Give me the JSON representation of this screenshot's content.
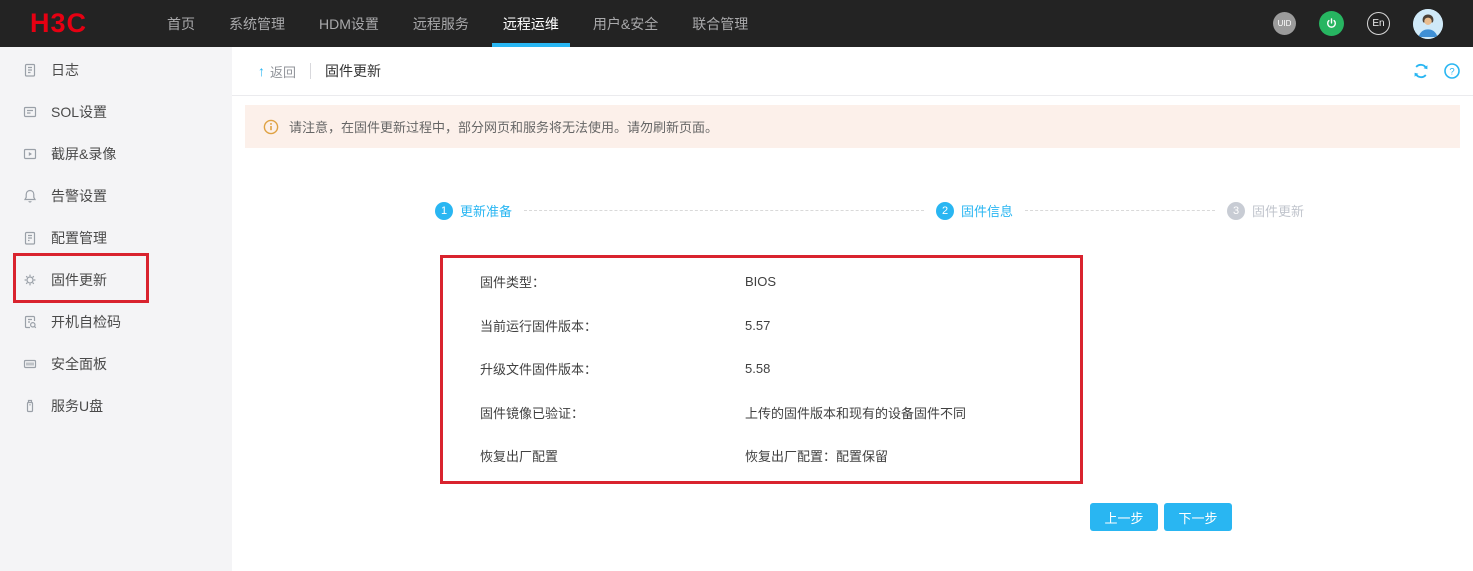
{
  "nav": {
    "logo_text": "H3C",
    "items": [
      {
        "label": "首页"
      },
      {
        "label": "系统管理"
      },
      {
        "label": "HDM设置"
      },
      {
        "label": "远程服务"
      },
      {
        "label": "远程运维",
        "active": true
      },
      {
        "label": "用户&安全"
      },
      {
        "label": "联合管理"
      }
    ],
    "uid_label": "UID",
    "language_label": "En"
  },
  "sidebar": {
    "items": [
      {
        "label": "日志",
        "icon": "log-icon"
      },
      {
        "label": "SOL设置",
        "icon": "sol-icon"
      },
      {
        "label": "截屏&录像",
        "icon": "screen-record-icon"
      },
      {
        "label": "告警设置",
        "icon": "alert-bell-icon"
      },
      {
        "label": "配置管理",
        "icon": "config-icon"
      },
      {
        "label": "固件更新",
        "icon": "firmware-gear-icon",
        "highlighted": true
      },
      {
        "label": "开机自检码",
        "icon": "post-code-icon"
      },
      {
        "label": "安全面板",
        "icon": "security-panel-icon"
      },
      {
        "label": "服务U盘",
        "icon": "usb-icon"
      }
    ]
  },
  "breadcrumb": {
    "back_arrow": "↑",
    "back_label": "返回",
    "title": "固件更新"
  },
  "banner": {
    "text": "请注意，在固件更新过程中，部分网页和服务将无法使用。请勿刷新页面。"
  },
  "stepper": {
    "steps": [
      {
        "num": "1",
        "label": "更新准备",
        "state": "active"
      },
      {
        "num": "2",
        "label": "固件信息",
        "state": "active"
      },
      {
        "num": "3",
        "label": "固件更新",
        "state": "pending"
      }
    ]
  },
  "firmware_info": {
    "rows": [
      {
        "label": "固件类型：",
        "value": "BIOS"
      },
      {
        "label": "当前运行固件版本：",
        "value": "5.57"
      },
      {
        "label": "升级文件固件版本：",
        "value": "5.58"
      },
      {
        "label": "固件镜像已验证：",
        "value": "上传的固件版本和现有的设备固件不同"
      },
      {
        "label": "恢复出厂配置",
        "value": "恢复出厂配置：配置保留"
      }
    ]
  },
  "actions": {
    "prev_label": "上一步",
    "next_label": "下一步"
  },
  "colors": {
    "accent_blue": "#29b6f2",
    "annotation_red": "#d9232e",
    "nav_bg": "#232323",
    "logo_red": "#e60012",
    "power_green": "#27b561",
    "banner_bg": "#fcf0ea",
    "banner_icon_orange": "#dfa243",
    "step_inactive_gray": "#c8ccd4"
  }
}
